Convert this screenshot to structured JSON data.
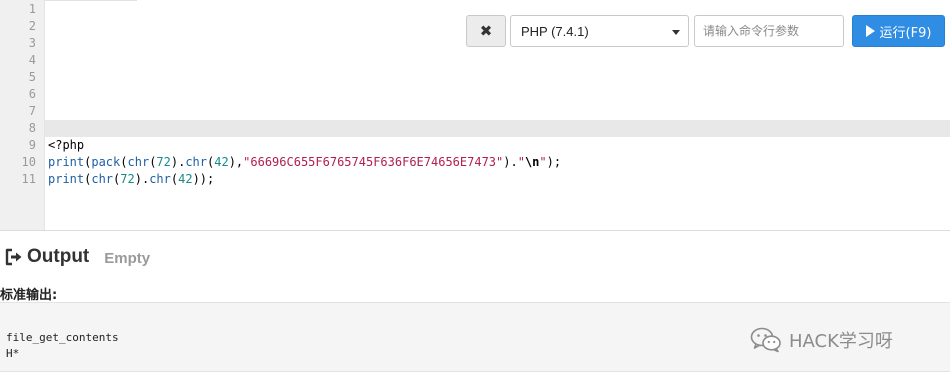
{
  "editor": {
    "line_numbers": [
      "1",
      "2",
      "3",
      "4",
      "5",
      "6",
      "7",
      "8",
      "9",
      "10",
      "11"
    ],
    "code": {
      "line9": "<?php",
      "line10": {
        "fn_print": "print",
        "p1": "(",
        "fn_pack": "pack",
        "p2": "(",
        "fn_chr1": "chr",
        "p3": "(",
        "num1": "72",
        "p4": ").",
        "fn_chr2": "chr",
        "p5": "(",
        "num2": "42",
        "p6": "),",
        "str": "\"66696C655F6765745F636F6E74656E7473\"",
        "p7": ").",
        "str2": "\"",
        "esc": "\\n",
        "str3": "\"",
        "p8": ");"
      },
      "line11": {
        "fn_print": "print",
        "p1": "(",
        "fn_chr1": "chr",
        "p2": "(",
        "num1": "72",
        "p3": ").",
        "fn_chr2": "chr",
        "p4": "(",
        "num2": "42",
        "p5": "));"
      }
    }
  },
  "toolbar": {
    "clear_label": "✖",
    "language": "PHP (7.4.1)",
    "args_placeholder": "请输入命令行参数",
    "run_label": "运行(F9)"
  },
  "output": {
    "title": "Output",
    "status": "Empty",
    "stdout_label": "标准输出:",
    "lines": [
      "file_get_contents",
      "H*"
    ]
  },
  "watermark": {
    "text": "HACK学习呀",
    "icon": "wechat-icon"
  },
  "colors": {
    "run_button": "#2f8de4",
    "function": "#1f5fa5",
    "number": "#148a8a",
    "string": "#b3204d"
  }
}
